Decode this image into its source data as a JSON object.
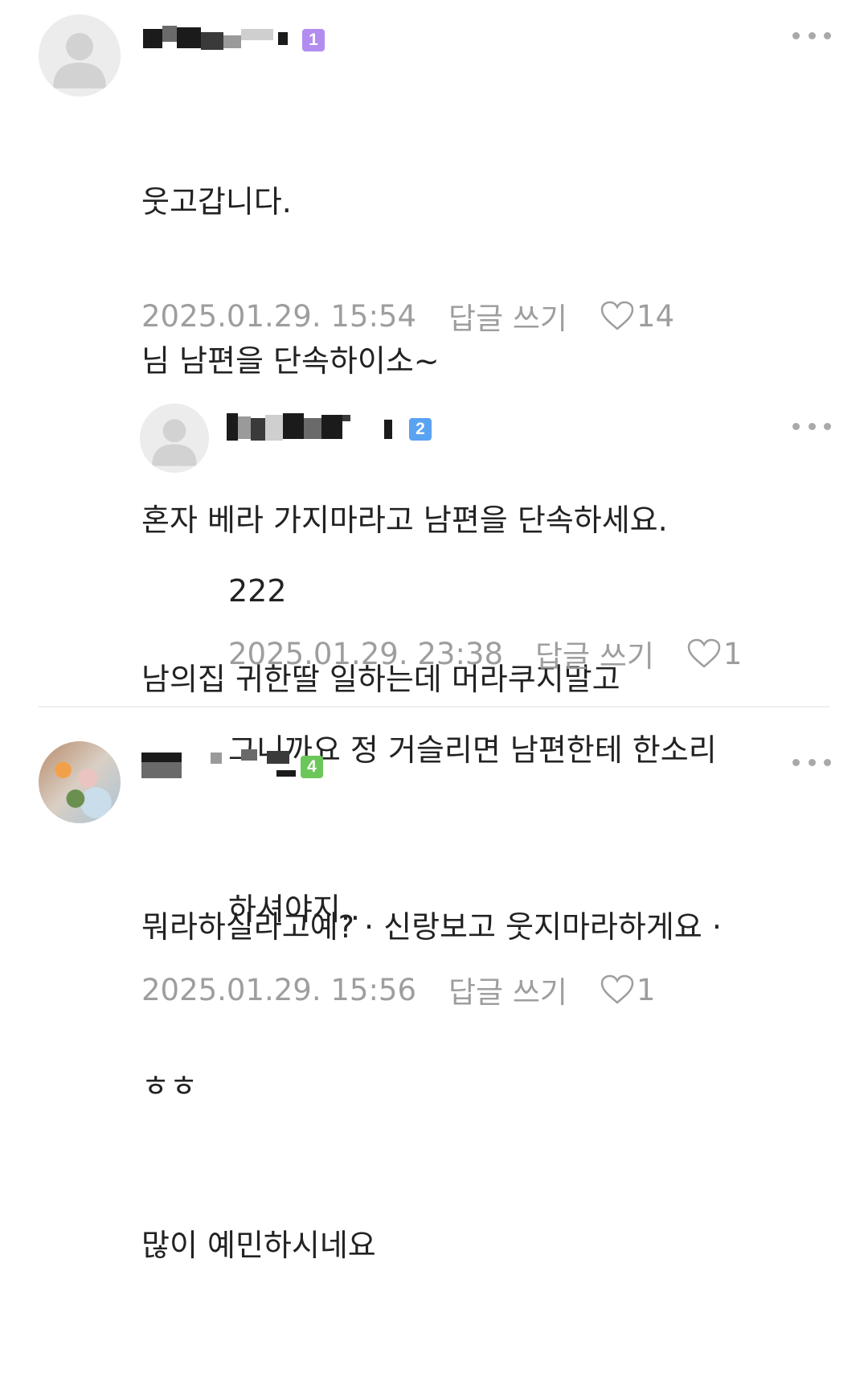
{
  "comments": [
    {
      "level": "1",
      "level_color": "#b38cf0",
      "lines": [
        "웃고갑니다.",
        "님 남편을 단속하이소~",
        "혼자 베라 가지마라고 남편을 단속하세요.",
        "남의집 귀한딸 일하는데 머라쿠지말고"
      ],
      "date": "2025.01.29. 15:54",
      "reply_label": "답글 쓰기",
      "likes": "14"
    },
    {
      "level": "2",
      "level_color": "#5aa2f2",
      "lines": [
        "222",
        "그니까요 정 거슬리면 남편한테 한소리",
        "하셔야지.."
      ],
      "date": "2025.01.29. 23:38",
      "reply_label": "답글 쓰기",
      "likes": "1"
    },
    {
      "level": "4",
      "level_color": "#6cc75a",
      "lines": [
        "뭐라하실라고예? · 신랑보고 웃지마라하게요 ·",
        "ㅎㅎ",
        "많이 예민하시네요"
      ],
      "date": "2025.01.29. 15:56",
      "reply_label": "답글 쓰기",
      "likes": "1"
    }
  ],
  "icons": {
    "avatar": "default-person-icon",
    "more": "more-dots-icon",
    "like": "heart-outline-icon"
  }
}
